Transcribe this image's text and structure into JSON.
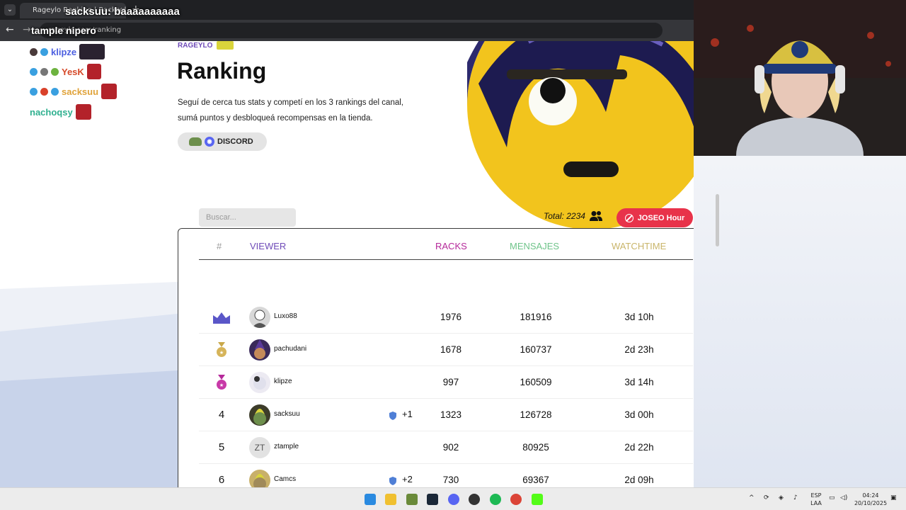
{
  "browser": {
    "tab_title": "Rageylo Ranking | Racks de l",
    "url_text": "rageylo.com/ranking"
  },
  "stream_chat": {
    "top_message_user": "sacksuu",
    "top_message_text": ": baaaaaaaaaa",
    "second_message": "tample nipero",
    "lines": [
      {
        "user": "klipze"
      },
      {
        "user": "YesK"
      },
      {
        "user": "sacksuu"
      },
      {
        "user": "nachoqsy"
      }
    ]
  },
  "header": {
    "eyebrow": "RAGEYLO",
    "title": "Ranking",
    "description": "Seguí de cerca tus stats y competí en los 3 rankings del canal, sumá puntos y desbloqueá recompensas en la tienda.",
    "discord_label": "DISCORD"
  },
  "toolbar": {
    "search_placeholder": "Buscar...",
    "total_label": "Total: 2234",
    "joseo_label": "JOSEO Hour"
  },
  "table": {
    "columns": {
      "rank": "#",
      "viewer": "VIEWER",
      "racks": "RACKS",
      "mensajes": "MENSAJES",
      "watchtime": "WATCHTIME"
    },
    "colors": {
      "rank": "#9a9a9a",
      "viewer": "#6f4bb8",
      "racks": "#b5289a",
      "mensajes": "#6fc48a",
      "watchtime": "#c9b56a"
    },
    "rows": [
      {
        "rank": "",
        "badge": "crown-icon",
        "avatar": "",
        "name": "Luxo88",
        "bonus": "",
        "racks": "1976",
        "mensajes": "181916",
        "watchtime": "3d 10h"
      },
      {
        "rank": "",
        "badge": "gold-medal-icon",
        "avatar": "",
        "name": "pachudani",
        "bonus": "",
        "racks": "1678",
        "mensajes": "160737",
        "watchtime": "2d 23h"
      },
      {
        "rank": "",
        "badge": "pink-medal-icon",
        "avatar": "",
        "name": "klipze",
        "bonus": "",
        "racks": "997",
        "mensajes": "160509",
        "watchtime": "3d 14h"
      },
      {
        "rank": "4",
        "badge": "",
        "avatar": "",
        "name": "sacksuu",
        "bonus": "+1",
        "racks": "1323",
        "mensajes": "126728",
        "watchtime": "3d 00h"
      },
      {
        "rank": "5",
        "badge": "",
        "avatar": "ZT",
        "name": "ztample",
        "bonus": "",
        "racks": "902",
        "mensajes": "80925",
        "watchtime": "2d 22h"
      },
      {
        "rank": "6",
        "badge": "",
        "avatar": "",
        "name": "Camcs",
        "bonus": "+2",
        "racks": "730",
        "mensajes": "69367",
        "watchtime": "2d 09h"
      }
    ]
  },
  "taskbar": {
    "lang_line1": "ESP",
    "lang_line2": "LAA",
    "time": "04:24",
    "date": "20/10/2025"
  }
}
